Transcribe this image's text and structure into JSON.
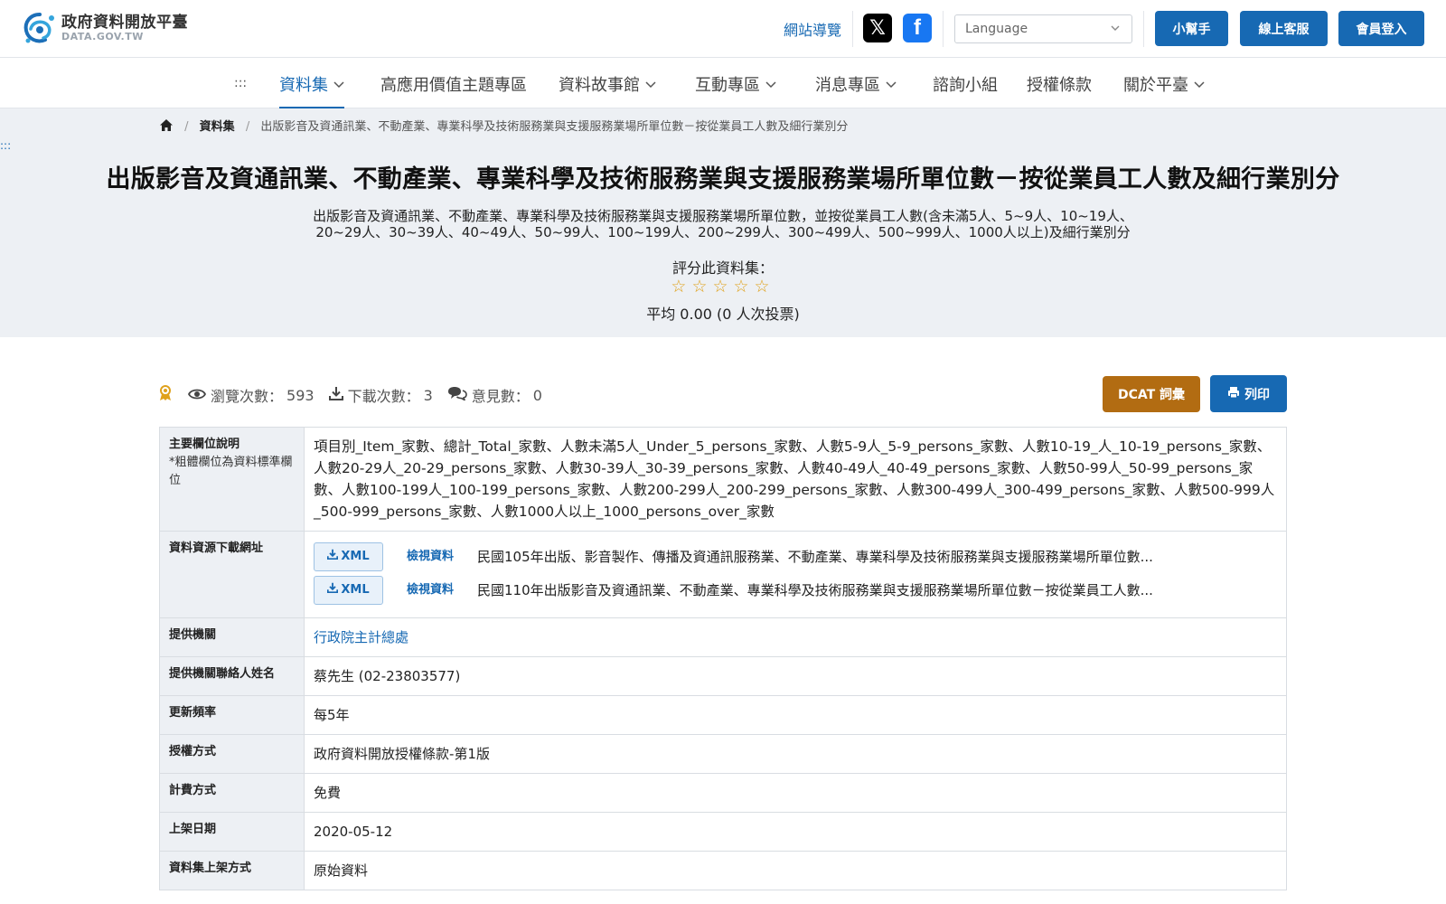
{
  "header": {
    "logo_title": "政府資料開放平臺",
    "logo_sub": "DATA.GOV.TW",
    "sitemap": "網站導覽",
    "social_x": "𝕏",
    "social_fb": "f",
    "language_placeholder": "Language",
    "buttons": [
      "小幫手",
      "線上客服",
      "會員登入"
    ]
  },
  "nav": {
    "dots": ":::",
    "items": [
      "資料集",
      "高應用價值主題專區",
      "資料故事館",
      "互動專區",
      "消息專區",
      "諮詢小組",
      "授權條款",
      "關於平臺"
    ]
  },
  "breadcrumb": {
    "level1": "資料集",
    "current": "出版影音及資通訊業、不動產業、專業科學及技術服務業與支援服務業場所單位數－按從業員工人數及細行業別分"
  },
  "hero": {
    "dots": ":::",
    "title": "出版影音及資通訊業、不動產業、專業科學及技術服務業與支援服務業場所單位數－按從業員工人數及細行業別分",
    "description": "出版影音及資通訊業、不動產業、專業科學及技術服務業與支援服務業場所單位數，並按從業員工人數(含未滿5人、5~9人、10~19人、20~29人、30~39人、40~49人、50~99人、100~199人、200~299人、300~499人、500~999人、1000人以上)及細行業別分",
    "rate_label": "評分此資料集：",
    "stars": "☆☆☆☆☆",
    "rating": 0,
    "avg": "平均 0.00 (0 人次投票)"
  },
  "stats": {
    "views_label": "瀏覽次數：",
    "views": "593",
    "downloads_label": "下載次數：",
    "downloads": "3",
    "comments_label": "意見數：",
    "comments": "0",
    "dcat": "DCAT 詞彙",
    "print": "列印"
  },
  "table": {
    "fields_label": "主要欄位說明",
    "fields_note": "*粗體欄位為資料標準欄位",
    "fields_value": "項目別_Item_家數、總計_Total_家數、人數未滿5人_Under_5_persons_家數、人數5-9人_5-9_persons_家數、人數10-19_人_10-19_persons_家數、人數20-29人_20-29_persons_家數、人數30-39人_30-39_persons_家數、人數40-49人_40-49_persons_家數、人數50-99人_50-99_persons_家數、人數100-199人_100-199_persons_家數、人數200-299人_200-299_persons_家數、人數300-499人_300-499_persons_家數、人數500-999人_500-999_persons_家數、人數1000人以上_1000_persons_over_家數",
    "download_label": "資料資源下載網址",
    "downloads": [
      {
        "format": "XML",
        "view": "檢視資料",
        "title": "民國105年出版、影音製作、傳播及資通訊服務業、不動產業、專業科學及技術服務業與支援服務業場所單位數..."
      },
      {
        "format": "XML",
        "view": "檢視資料",
        "title": "民國110年出版影音及資通訊業、不動產業、專業科學及技術服務業與支援服務業場所單位數－按從業員工人數..."
      }
    ],
    "rows": [
      {
        "label": "提供機關",
        "value": "行政院主計總處",
        "link": true
      },
      {
        "label": "提供機關聯絡人姓名",
        "value": "蔡先生 (02-23803577)"
      },
      {
        "label": "更新頻率",
        "value": "每5年"
      },
      {
        "label": "授權方式",
        "value": "政府資料開放授權條款-第1版"
      },
      {
        "label": "計費方式",
        "value": "免費"
      },
      {
        "label": "上架日期",
        "value": "2020-05-12"
      },
      {
        "label": "資料集上架方式",
        "value": "原始資料"
      }
    ]
  }
}
